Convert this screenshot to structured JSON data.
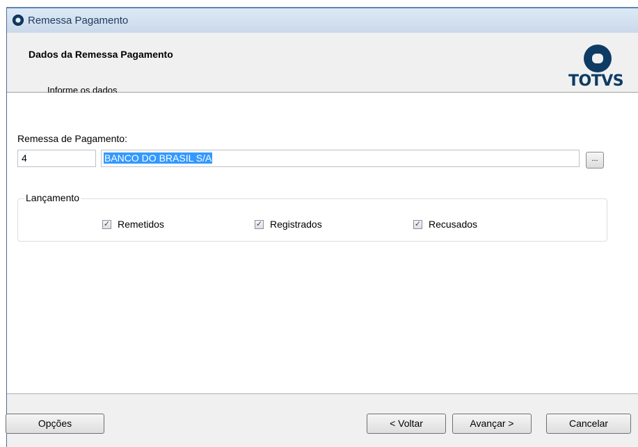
{
  "window": {
    "title": "Remessa Pagamento"
  },
  "header": {
    "title": "Dados da Remessa Pagamento",
    "subtitle": "Informe os dados",
    "logo_text": "TOTVS"
  },
  "form": {
    "remessa_label": "Remessa de Pagamento:",
    "code_value": "4",
    "description_value": "BANCO DO BRASIL S/A",
    "browse_label": "..."
  },
  "lancamento": {
    "legend": "Lançamento",
    "options": [
      {
        "label": "Remetidos",
        "checked": true
      },
      {
        "label": "Registrados",
        "checked": true
      },
      {
        "label": "Recusados",
        "checked": true
      }
    ]
  },
  "footer": {
    "options_label": "Opções",
    "back_label": "< Voltar",
    "next_label": "Avançar >",
    "cancel_label": "Cancelar"
  },
  "colors": {
    "brand": "#0e3b64",
    "selection": "#3399ff"
  }
}
